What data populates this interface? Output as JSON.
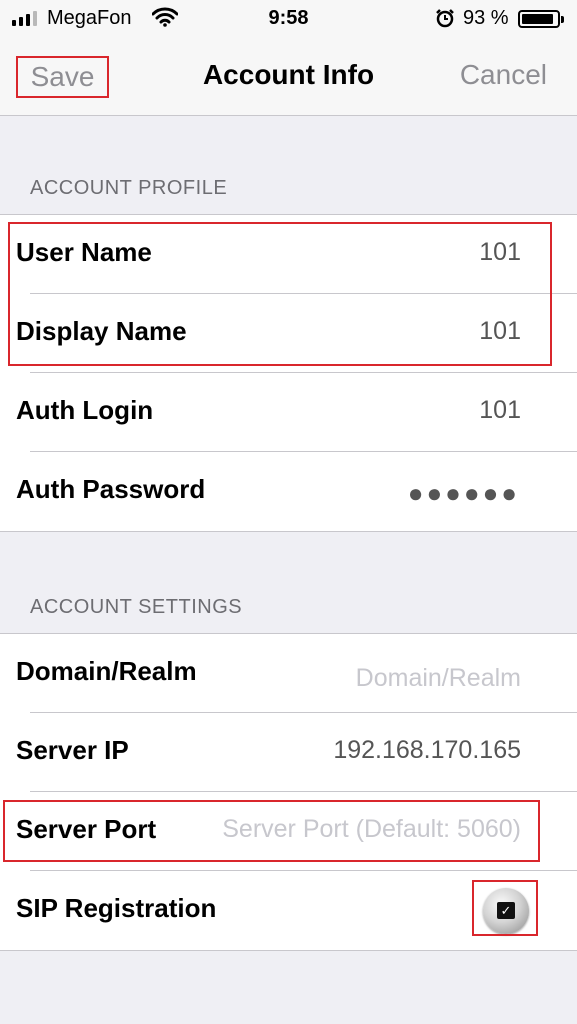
{
  "status_bar": {
    "carrier": "MegaFon",
    "time": "9:58",
    "battery": "93 %",
    "icons": [
      "signal-icon",
      "wifi-icon",
      "alarm-icon",
      "battery-icon"
    ]
  },
  "nav": {
    "save": "Save",
    "title": "Account Info",
    "cancel": "Cancel"
  },
  "account_profile": {
    "header": "ACCOUNT PROFILE",
    "rows": [
      {
        "label": "User Name",
        "value": "101"
      },
      {
        "label": "Display Name",
        "value": "101"
      },
      {
        "label": "Auth Login",
        "value": "101"
      },
      {
        "label": "Auth Password",
        "value": "●●●●●●"
      }
    ]
  },
  "account_settings": {
    "header": "ACCOUNT SETTINGS",
    "rows": [
      {
        "label": "Domain/Realm",
        "placeholder": "Domain/Realm"
      },
      {
        "label": "Server IP",
        "value": "192.168.170.165"
      },
      {
        "label": "Server Port",
        "placeholder": "Server Port (Default: 5060)"
      },
      {
        "label": "SIP Registration",
        "checked": true
      }
    ]
  },
  "colors": {
    "highlight": "#d9262c",
    "background": "#efeff4",
    "nav_gray": "#8e8e93",
    "placeholder": "#c7c7cd"
  }
}
